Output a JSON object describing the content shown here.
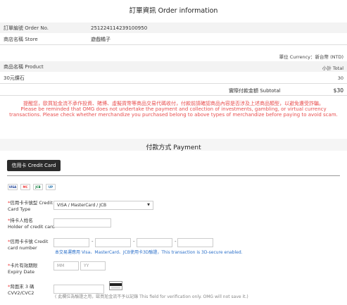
{
  "order": {
    "title": "訂單資訊 Order information",
    "order_no_label": "訂單編號 Order No.",
    "order_no_value": "251224114239100950",
    "store_label": "商店名稱 Store",
    "store_value": "遊戲橘子",
    "currency_label": "單位 Currency：新台幣 (NTD)",
    "product_header": "商品名稱 Product",
    "total_header": "小計 Total",
    "product_name": "30元鑽石",
    "product_total": "30",
    "subtotal_label": "實際付款金額 Subtotal",
    "subtotal_value": "$30",
    "warning_zh": "提醒您，歐買尬金流不承作投資、賭博、虛擬貨幣等商品交易代碼收付，付款前請確認商品內容是否涉及上述商品類型，以避免遭受詐騙。",
    "warning_en": "Please be reminded that OMG does not undertake the payment and collection of investments, gambling, or virtual currency transactions. Please check whether merchandize you purchased belong to above types of merchandize before paying to avoid scam."
  },
  "payment": {
    "title": "付款方式 Payment",
    "credit_card_button": "信用卡 Credit Card",
    "card_logos": [
      "VISA",
      "MC",
      "JCB",
      "UP"
    ],
    "card_type_label_zh": "信用卡卡號型",
    "card_type_label_en1": "Credit",
    "card_type_label_en2": "Card Type",
    "card_type_value": "VISA / MasterCard / JCB",
    "holder_label_zh": "持卡人姓名",
    "holder_label_en": "Holder of credit card",
    "card_no_label_zh": "信用卡卡號",
    "card_no_label_en1": "Credit",
    "card_no_label_en2": "card number",
    "card_no_hint": "本交易運應用 Visa、MasterCard、JCB使用卡3D驗證，This transaction is 3D-secure enabled.",
    "expiry_label_zh": "卡片有效期限",
    "expiry_label_en": "Expiry Date",
    "expiry_mm_placeholder": "MM",
    "expiry_yy_placeholder": "YY",
    "cvv_label_zh": "背面末 3 碼",
    "cvv_label_en": "CVV2/CVC2",
    "cvv_note": "( 此欄位為驗證之用，歐買尬金流不予以記錄 This field for verification only. OMG will not save it.)"
  }
}
